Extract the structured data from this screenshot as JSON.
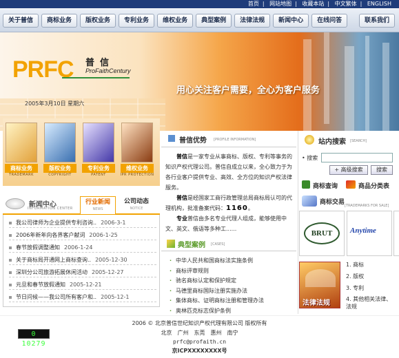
{
  "topbar": {
    "links": [
      "首页",
      "网站地图",
      "收藏本站",
      "中文繁体",
      "ENGLISH"
    ]
  },
  "nav": {
    "items": [
      "关于普信",
      "商标业务",
      "版权业务",
      "专利业务",
      "维权业务",
      "典型案例",
      "法律法规",
      "新闻中心",
      "在线问答",
      "联系我们"
    ]
  },
  "banner": {
    "logo_text": "PRFC",
    "logo_cn": "普信",
    "logo_en": "ProFaithCentury",
    "slogan": "用心关注客户需要，全心为客户服务",
    "date": "2005年3月10日 星期六"
  },
  "services": [
    {
      "label": "商标业务",
      "sub": "TRADEMARK"
    },
    {
      "label": "版权业务",
      "sub": "COPYRIGHT"
    },
    {
      "label": "专利业务",
      "sub": "PATENT"
    },
    {
      "label": "维权业务",
      "sub": "IPR PROTECTION"
    }
  ],
  "news": {
    "title": "新闻中心",
    "subtitle": "INFORMATION CENTER",
    "tab_industry": "行业新闻",
    "tab_industry_sub": "NEWS",
    "tab_company": "公司动态",
    "tab_company_sub": "NOTICE",
    "items": [
      {
        "text": "我公司律师为企业提供专利咨询..",
        "date": "2006-3-1"
      },
      {
        "text": "2006年新年向各界客户献词",
        "date": "2006-1-25"
      },
      {
        "text": "春节放假调整通知",
        "date": "2006-1-24"
      },
      {
        "text": "关于商标局开通网上商标查询..",
        "date": "2005-12-30"
      },
      {
        "text": "深圳分公司旅游拓展休闲活动",
        "date": "2005-12-27"
      },
      {
        "text": "元旦和春节放假通知",
        "date": "2005-12-21"
      },
      {
        "text": "节日问候——我公司所有客户和..",
        "date": "2005-12-1"
      }
    ]
  },
  "profile": {
    "title": "普信优势",
    "subtitle": "[PROFILE INFORMATION]",
    "p1_lead": "普信",
    "p1": "是一家专业从事商标、版权、专利等事务的知识产权代理公司。普信自成立以来，全心致力于为各行业客户提供专业、高效、全方位的知识产权法律服务。",
    "p2_lead": "普信",
    "p2": "是经国家工商行政管理总局商标局认可的代理机构，批准备案代码：",
    "code": "1160",
    "p3_lead": "专业",
    "p3": "普信由多名专业代理人组成，能够使用中文、英文、俄语等多种工......"
  },
  "cases": {
    "title": "典型案例",
    "subtitle": "[CASES]",
    "items": [
      "中华人民共和国商标法实施条例",
      "商标评审规则",
      "驰名商标认定和保护规定",
      "马德里商标国际注册实施办法",
      "集体商标、证明商标注册和管理办法",
      "奥林匹克标志保护条例"
    ]
  },
  "search": {
    "title": "站内搜索",
    "subtitle": "[SEARCH]",
    "label": "搜索",
    "advanced": "高级搜索",
    "button": "搜索"
  },
  "right": {
    "trademark_query": "商标查询",
    "goods_classes": "商品分类表",
    "trademark_sale": "商标交易",
    "trademark_sale_sub": "[TRADEMARKS FOR SALE]",
    "sale_brand_1": "BRUT",
    "sale_brand_2": "Anytime",
    "law_label": "法律法规",
    "list": [
      "1. 商标",
      "2. 版权",
      "3. 专利",
      "4. 其他相关法律、法规"
    ]
  },
  "footer": {
    "copyright": "2006 © 北京普信世纪知识产权代理有限公司 版权所有",
    "cities": "北京　广州　东莞　惠州　南宁",
    "email": "prfc@profaith.cn",
    "icp": "京ICPXXXXXXXX号",
    "counter": "0 10279"
  },
  "colors": {
    "accent_orange": "#f2a200",
    "nav_blue": "#1f3c7a",
    "green": "#2f8f3a"
  }
}
